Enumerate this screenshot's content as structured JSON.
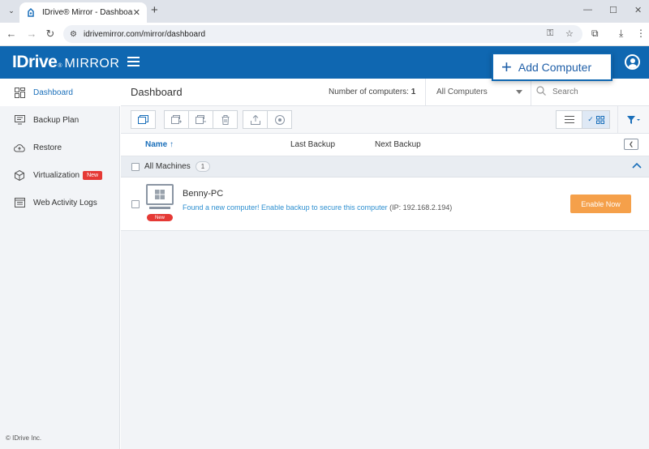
{
  "browser": {
    "tab_title": "IDrive® Mirror - Dashboard",
    "url": "idrivemirror.com/mirror/dashboard"
  },
  "header": {
    "logo_main": "IDrive",
    "logo_reg": "®",
    "logo_product": "MIRROR",
    "add_computer_label": "Add Computer"
  },
  "sidebar": {
    "items": [
      {
        "label": "Dashboard",
        "icon": "dashboard-icon",
        "active": true
      },
      {
        "label": "Backup Plan",
        "icon": "monitor-icon"
      },
      {
        "label": "Restore",
        "icon": "cloud-restore-icon"
      },
      {
        "label": "Virtualization",
        "icon": "cube-icon",
        "badge": "New"
      },
      {
        "label": "Web Activity Logs",
        "icon": "logs-icon"
      }
    ],
    "footer": "© IDrive Inc."
  },
  "main": {
    "title": "Dashboard",
    "count_label": "Number of computers:",
    "count_value": "1",
    "filter_select": "All Computers",
    "search_placeholder": "Search",
    "columns": {
      "name": "Name",
      "last_backup": "Last Backup",
      "next_backup": "Next Backup"
    },
    "group": {
      "label": "All Machines",
      "count": "1"
    },
    "machine": {
      "name": "Benny-PC",
      "badge": "New",
      "message": "Found a new computer! Enable backup to secure this computer",
      "ip": "(IP: 192.168.2.194)",
      "action_label": "Enable Now"
    }
  },
  "colors": {
    "brand_blue": "#0f67b1",
    "accent_orange": "#f5a04a",
    "badge_red": "#e53935",
    "link_blue": "#2d8fd0"
  }
}
